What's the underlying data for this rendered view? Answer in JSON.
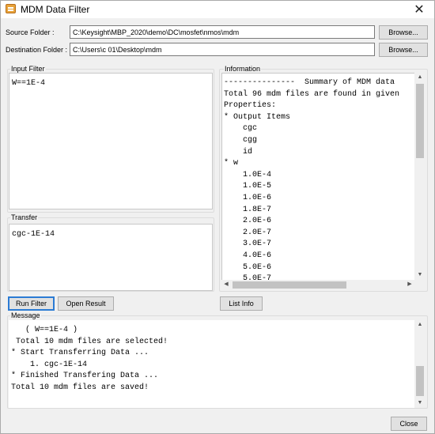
{
  "window": {
    "title": "MDM Data Filter",
    "close_glyph": "✕"
  },
  "source": {
    "label": "Source Folder :",
    "value": "C:\\Keysight\\MBP_2020\\demo\\DC\\mosfet\\nmos\\mdm",
    "browse_label": "Browse..."
  },
  "destination": {
    "label": "Destination Folder :",
    "value": "C:\\Users\\c     01\\Desktop\\mdm",
    "browse_label": "Browse..."
  },
  "input_filter": {
    "label": "Input Filter",
    "text": "W==1E-4"
  },
  "transfer": {
    "label": "Transfer",
    "text": "cgc-1E-14"
  },
  "information": {
    "label": "Information",
    "text": "---------------  Summary of MDM data\nTotal 96 mdm files are found in given\nProperties:\n* Output Items\n    cgc\n    cgg\n    id\n* w\n    1.0E-4\n    1.0E-5\n    1.0E-6\n    1.8E-7\n    2.0E-6\n    2.0E-7\n    3.0E-7\n    4.0E-6\n    5.0E-6\n    5.0E-7"
  },
  "buttons": {
    "run_filter": "Run Filter",
    "open_result": "Open Result",
    "list_info": "List Info",
    "close": "Close"
  },
  "message": {
    "label": "Message",
    "text": "   ( W==1E-4 )\n Total 10 mdm files are selected!\n* Start Transferring Data ...\n    1. cgc-1E-14\n* Finished Transfering Data ...\nTotal 10 mdm files are saved!"
  },
  "icons": {
    "app": "folder-icon",
    "scroll_up": "▲",
    "scroll_down": "▼",
    "scroll_left": "◀",
    "scroll_right": "▶"
  }
}
